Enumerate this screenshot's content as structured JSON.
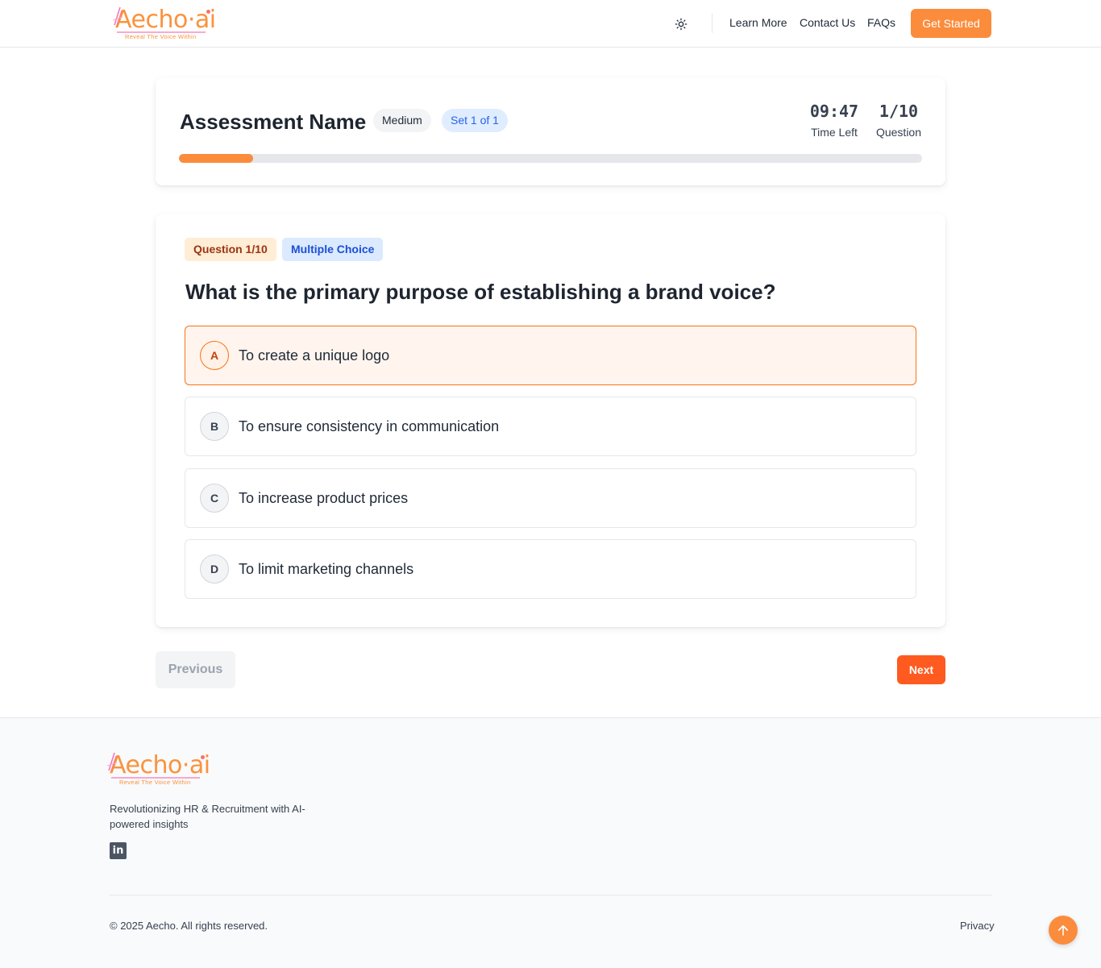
{
  "header": {
    "logo": {
      "wordmark": "Aecho·ai",
      "tagline": "Reveal The Voice Within"
    },
    "nav": {
      "learn_more": "Learn More",
      "contact_us": "Contact Us",
      "faqs": "FAQs",
      "get_started": "Get Started"
    },
    "theme_icon": "sun-icon"
  },
  "assessment": {
    "title": "Assessment Name",
    "difficulty": "Medium",
    "set": "Set 1 of 1",
    "time_left_value": "09:47",
    "time_left_label": "Time Left",
    "question_value": "1/10",
    "question_label": "Question",
    "progress_percent": 10
  },
  "question": {
    "tag_number": "Question 1/10",
    "tag_type": "Multiple Choice",
    "text": "What is the primary purpose of establishing a brand voice?",
    "options": [
      {
        "letter": "A",
        "text": "To create a unique logo",
        "selected": true
      },
      {
        "letter": "B",
        "text": "To ensure consistency in communication",
        "selected": false
      },
      {
        "letter": "C",
        "text": "To increase product prices",
        "selected": false
      },
      {
        "letter": "D",
        "text": "To limit marketing channels",
        "selected": false
      }
    ]
  },
  "navigation": {
    "previous": "Previous",
    "next": "Next"
  },
  "footer": {
    "logo": {
      "wordmark": "Aecho·ai",
      "tagline": "Reveal The Voice Within"
    },
    "description": "Revolutionizing HR & Recruitment with AI-powered insights",
    "social_icon": "linkedin-icon",
    "linkedin_glyph": "in",
    "copyright": "© 2025 Aecho. All rights reserved.",
    "privacy": "Privacy"
  },
  "scroll_top_icon": "arrow-up-icon",
  "colors": {
    "accent": "#fb8c3c",
    "next_button": "#ff5a1f",
    "selected_border": "#f97316",
    "set_pill_text": "#2563eb"
  }
}
